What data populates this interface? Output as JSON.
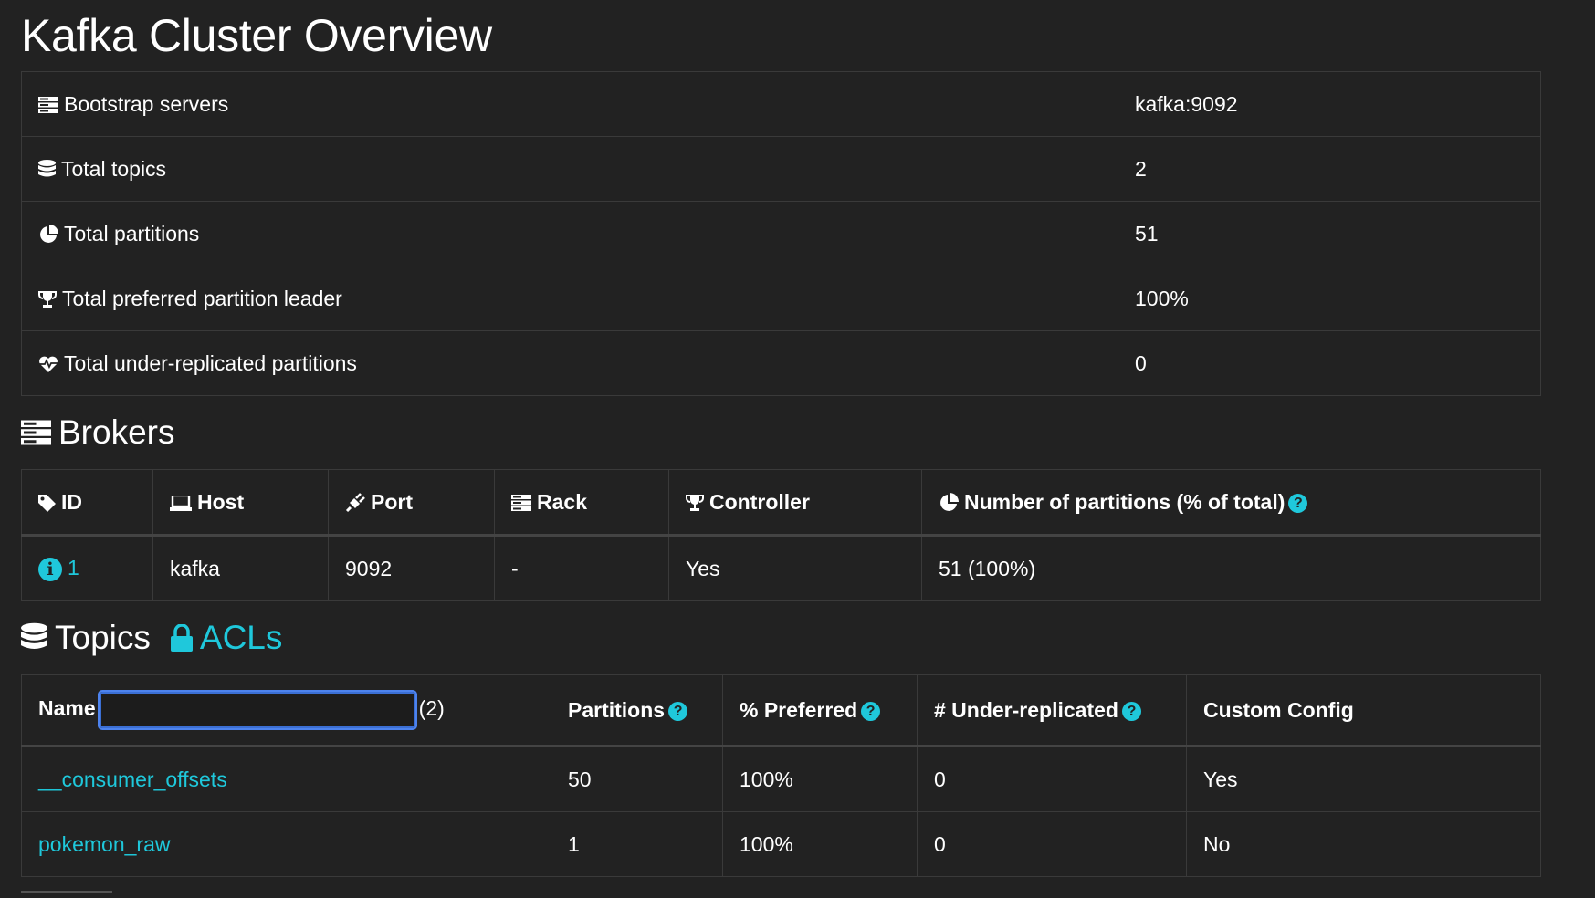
{
  "page": {
    "title": "Kafka Cluster Overview"
  },
  "overview": [
    {
      "label": "Bootstrap servers",
      "value": "kafka:9092",
      "icon": "server-icon"
    },
    {
      "label": "Total topics",
      "value": "2",
      "icon": "database-icon"
    },
    {
      "label": "Total partitions",
      "value": "51",
      "icon": "pie-chart-icon"
    },
    {
      "label": "Total preferred partition leader",
      "value": "100%",
      "icon": "trophy-icon"
    },
    {
      "label": "Total under-replicated partitions",
      "value": "0",
      "icon": "heartbeat-icon"
    }
  ],
  "brokers": {
    "heading": "Brokers",
    "columns": {
      "id": "ID",
      "host": "Host",
      "port": "Port",
      "rack": "Rack",
      "controller": "Controller",
      "partitions": "Number of partitions (% of total)"
    },
    "rows": [
      {
        "id": "1",
        "host": "kafka",
        "port": "9092",
        "rack": "-",
        "controller": "Yes",
        "partitions": "51 (100%)"
      }
    ]
  },
  "topics": {
    "heading": "Topics",
    "acls_link": "ACLs",
    "filter": {
      "value": "",
      "count": "(2)"
    },
    "columns": {
      "name": "Name",
      "partitions": "Partitions",
      "preferred": "% Preferred",
      "under_replicated": "# Under-replicated",
      "custom_config": "Custom Config"
    },
    "rows": [
      {
        "name": "__consumer_offsets",
        "partitions": "50",
        "preferred": "100%",
        "under_replicated": "0",
        "custom_config": "Yes"
      },
      {
        "name": "pokemon_raw",
        "partitions": "1",
        "preferred": "100%",
        "under_replicated": "0",
        "custom_config": "No"
      }
    ]
  },
  "colors": {
    "background": "#222222",
    "accent": "#1fc8db",
    "border": "#3a3a3a",
    "focus": "#3b6fd4"
  }
}
